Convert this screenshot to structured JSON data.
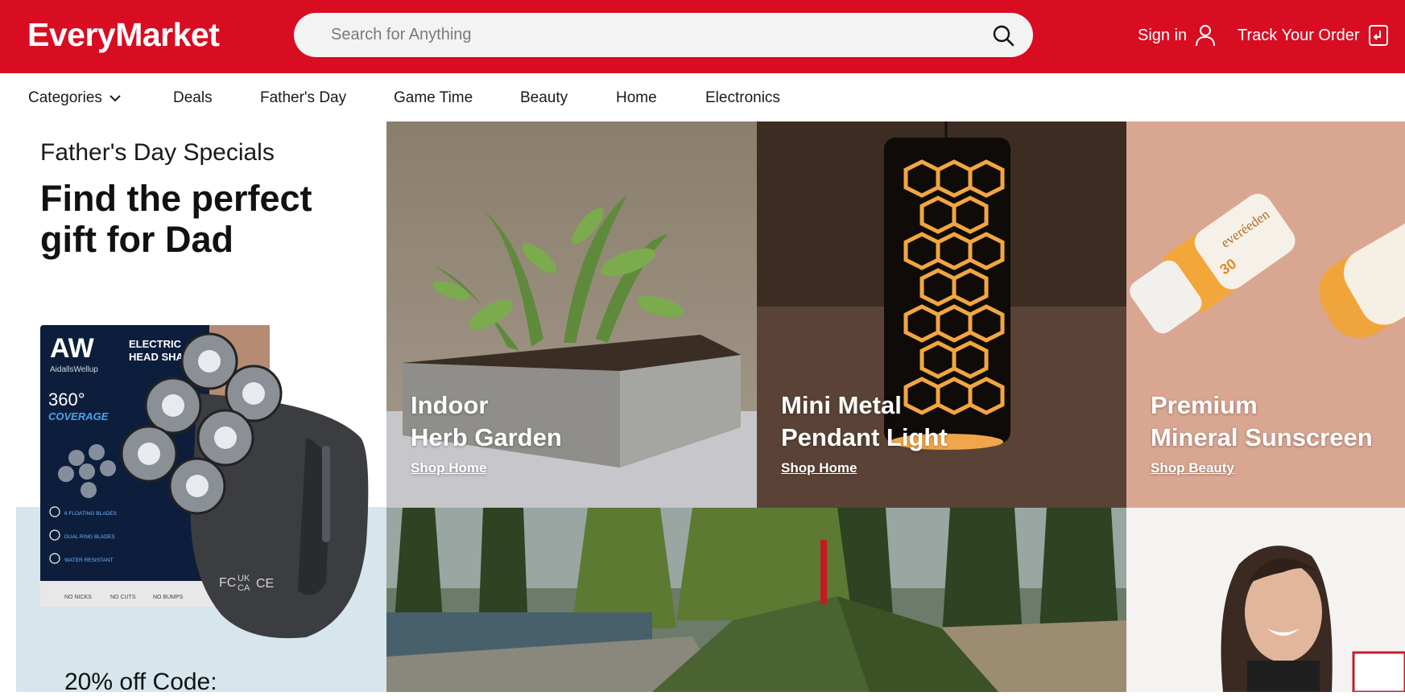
{
  "header": {
    "logo": "EveryMarket",
    "search_placeholder": "Search for Anything",
    "sign_in": "Sign in",
    "track_order": "Track Your Order",
    "brand_color": "#d80d22"
  },
  "nav": {
    "items": [
      {
        "label": "Categories",
        "has_dropdown": true
      },
      {
        "label": "Deals"
      },
      {
        "label": "Father's Day"
      },
      {
        "label": "Game Time"
      },
      {
        "label": "Beauty"
      },
      {
        "label": "Home"
      },
      {
        "label": "Electronics"
      }
    ]
  },
  "promo": {
    "subtitle": "Father's Day Specials",
    "title": "Find the perfect gift for Dad",
    "code_text": "20% off Code:",
    "product_box": {
      "brand_mark": "AW",
      "brand_name": "AidallsWellup",
      "product_title_line1": "ELECTRIC",
      "product_title_line2": "HEAD SHAVER",
      "coverage_value": "360°",
      "coverage_label": "COVERAGE",
      "features": [
        "6 FLOATING BLADES",
        "DUAL RING BLADES",
        "WATER RESISTANT"
      ],
      "footer": [
        "NO NICKS",
        "NO CUTS",
        "NO BUMPS"
      ]
    }
  },
  "tiles": [
    {
      "title_line1": "Indoor",
      "title_line2": "Herb Garden",
      "link": "Shop Home",
      "image": "herb-planter-photo"
    },
    {
      "title_line1": "Mini Metal",
      "title_line2": "Pendant Light",
      "link": "Shop Home",
      "image": "pendant-lamp-photo"
    },
    {
      "title_line1": "Premium",
      "title_line2": "Mineral Sunscreen",
      "link": "Shop Beauty",
      "image": "sunscreen-tubes-photo",
      "tube_label": "everéeden",
      "spf": "30"
    },
    {
      "image": "camping-tent-photo"
    },
    {
      "image": "smiling-woman-photo"
    }
  ]
}
